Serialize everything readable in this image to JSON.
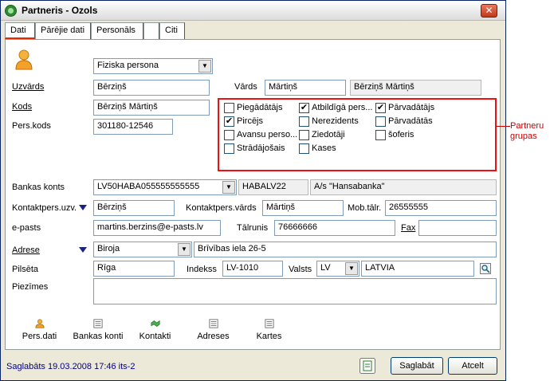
{
  "window": {
    "title": "Partneris - Ozols",
    "close_glyph": "✕"
  },
  "tabs": [
    {
      "label": "Dati",
      "active": true
    },
    {
      "label": "Pārējie dati",
      "active": false
    },
    {
      "label": "Personāls",
      "active": false
    },
    {
      "label": "",
      "active": false
    },
    {
      "label": "Citi",
      "active": false
    }
  ],
  "form": {
    "person_type": "Fiziska persona",
    "uzvards_label": "Uzvārds",
    "uzvards_value": "Bērziņš",
    "vards_label": "Vārds",
    "vards_value": "Mārtiņš",
    "full_name": "Bērziņš Mārtiņš",
    "kods_label": "Kods",
    "kods_value": "Bērziņš Mārtiņš",
    "perskods_label": "Pers.kods",
    "perskods_value": "301180-12546",
    "bank_label": "Bankas konts",
    "bank_account": "LV50HABA055555555555",
    "bank_code": "HABALV22",
    "bank_name": "A/s \"Hansabanka\"",
    "contact_surname_label": "Kontaktpers.uzv.",
    "contact_surname": "Bērziņš",
    "contact_name_label": "Kontaktpers.vārds",
    "contact_name": "Mārtiņš",
    "mobile_label": "Mob.tālr.",
    "mobile": "26555555",
    "email_label": "e-pasts",
    "email": "martins.berzins@e-pasts.lv",
    "phone_label": "Tālrunis",
    "phone": "76666666",
    "fax_label": "Fax",
    "fax": "",
    "address_label": "Adrese",
    "address_type": "Biroja",
    "address": "Brīvības iela 26-5",
    "city_label": "Pilsēta",
    "city": "Rīga",
    "index_label": "Indekss",
    "index": "LV-1010",
    "country_label": "Valsts",
    "country_code": "LV",
    "country_name": "LATVIA",
    "notes_label": "Piezīmes",
    "notes": ""
  },
  "groups": [
    {
      "label": "Piegādātājs",
      "checked": false
    },
    {
      "label": "Atbildīgā pers...",
      "checked": true
    },
    {
      "label": "Pārvadātājs",
      "checked": true
    },
    {
      "label": "Pircējs",
      "checked": true
    },
    {
      "label": "Nerezidents",
      "checked": false
    },
    {
      "label": "Pārvadātās",
      "checked": false
    },
    {
      "label": "Avansu perso...",
      "checked": false
    },
    {
      "label": "Ziedotāji",
      "checked": false
    },
    {
      "label": "šoferis",
      "checked": false
    },
    {
      "label": "Strādājošais",
      "checked": false
    },
    {
      "label": "Kases",
      "checked": false
    }
  ],
  "annotation": {
    "line1": "Partneru",
    "line2": "grupas"
  },
  "toolbar": [
    {
      "label": "Pers.dati",
      "icon": "person-icon"
    },
    {
      "label": "Bankas konti",
      "icon": "list-icon"
    },
    {
      "label": "Kontakti",
      "icon": "handshake-icon"
    },
    {
      "label": "Adreses",
      "icon": "list-icon"
    },
    {
      "label": "Kartes",
      "icon": "list-icon"
    }
  ],
  "status": {
    "text": "Saglabāts 19.03.2008 17:46 its-2"
  },
  "buttons": {
    "save": "Saglabāt",
    "cancel": "Atcelt"
  },
  "colors": {
    "accent": "#e11111",
    "status_text": "#000080",
    "highlight": "#cc0000"
  }
}
